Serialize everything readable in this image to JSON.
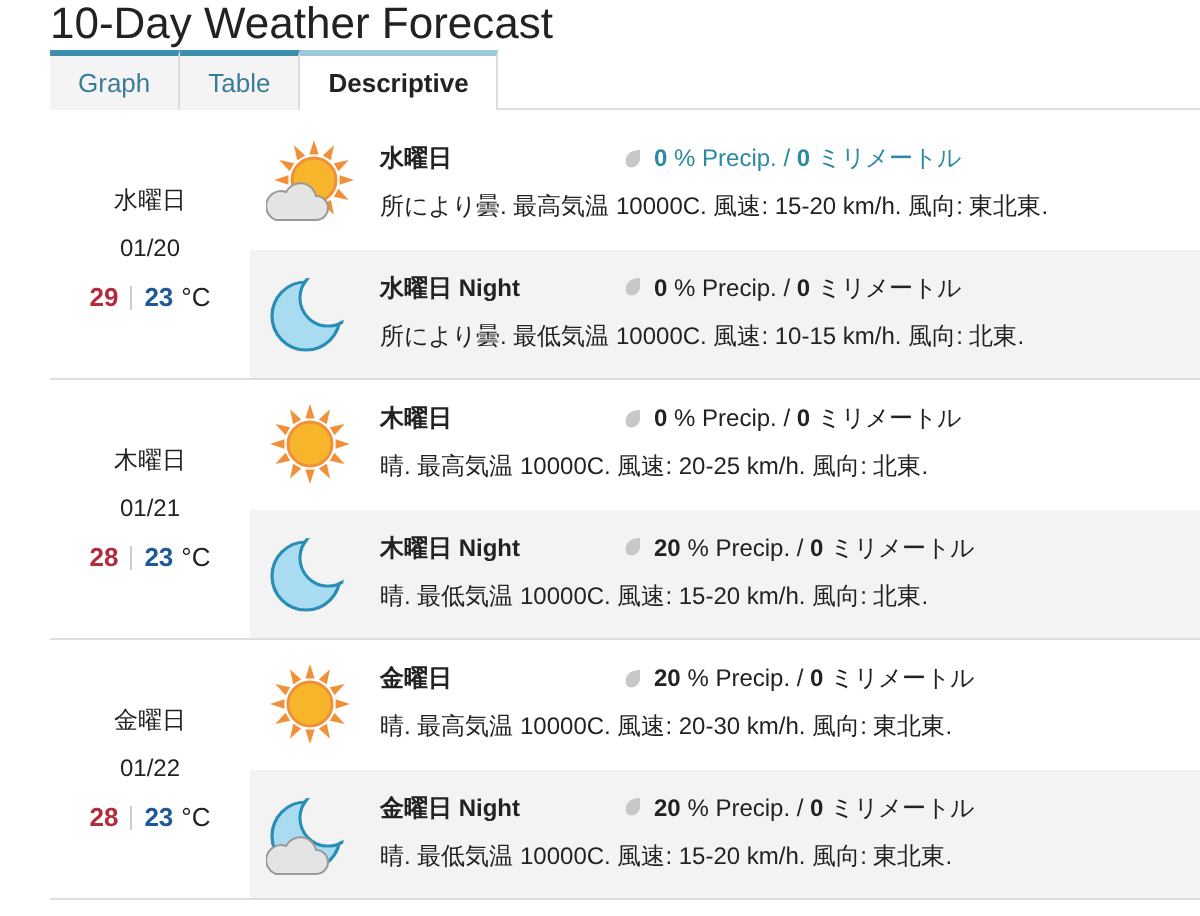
{
  "title": "10-Day Weather Forecast",
  "tabs": [
    {
      "label": "Graph",
      "selected": false
    },
    {
      "label": "Table",
      "selected": false
    },
    {
      "label": "Descriptive",
      "selected": true
    }
  ],
  "days": [
    {
      "weekday": "水曜日",
      "date": "01/20",
      "high": "29",
      "low": "23",
      "unit": "°C",
      "periods": [
        {
          "kind": "sun_cloud",
          "night": false,
          "title": "水曜日",
          "precip": "**0** % Precip. / **0** ミリメートル",
          "highlighted": true,
          "text": "所により曇. 最高気温 10000C. 風速: 15-20 km/h. 風向: 東北東."
        },
        {
          "kind": "moon",
          "night": true,
          "title": "水曜日 Night",
          "precip": "**0** % Precip. / **0** ミリメートル",
          "highlighted": false,
          "text": "所により曇. 最低気温 10000C. 風速: 10-15 km/h. 風向: 北東."
        }
      ]
    },
    {
      "weekday": "木曜日",
      "date": "01/21",
      "high": "28",
      "low": "23",
      "unit": "°C",
      "periods": [
        {
          "kind": "sun",
          "night": false,
          "title": "木曜日",
          "precip": "**0** % Precip. / **0** ミリメートル",
          "highlighted": false,
          "text": "晴. 最高気温 10000C. 風速: 20-25 km/h. 風向: 北東."
        },
        {
          "kind": "moon",
          "night": true,
          "title": "木曜日 Night",
          "precip": "**20** % Precip. / **0** ミリメートル",
          "highlighted": false,
          "text": "晴. 最低気温 10000C. 風速: 15-20 km/h. 風向: 北東."
        }
      ]
    },
    {
      "weekday": "金曜日",
      "date": "01/22",
      "high": "28",
      "low": "23",
      "unit": "°C",
      "periods": [
        {
          "kind": "sun",
          "night": false,
          "title": "金曜日",
          "precip": "**20** % Precip. / **0** ミリメートル",
          "highlighted": false,
          "text": "晴. 最高気温 10000C. 風速: 20-30 km/h. 風向: 東北東."
        },
        {
          "kind": "moon_cloud",
          "night": true,
          "title": "金曜日 Night",
          "precip": "**20** % Precip. / **0** ミリメートル",
          "highlighted": false,
          "text": "晴. 最低気温 10000C. 風速: 15-20 km/h. 風向: 東北東."
        }
      ]
    }
  ]
}
